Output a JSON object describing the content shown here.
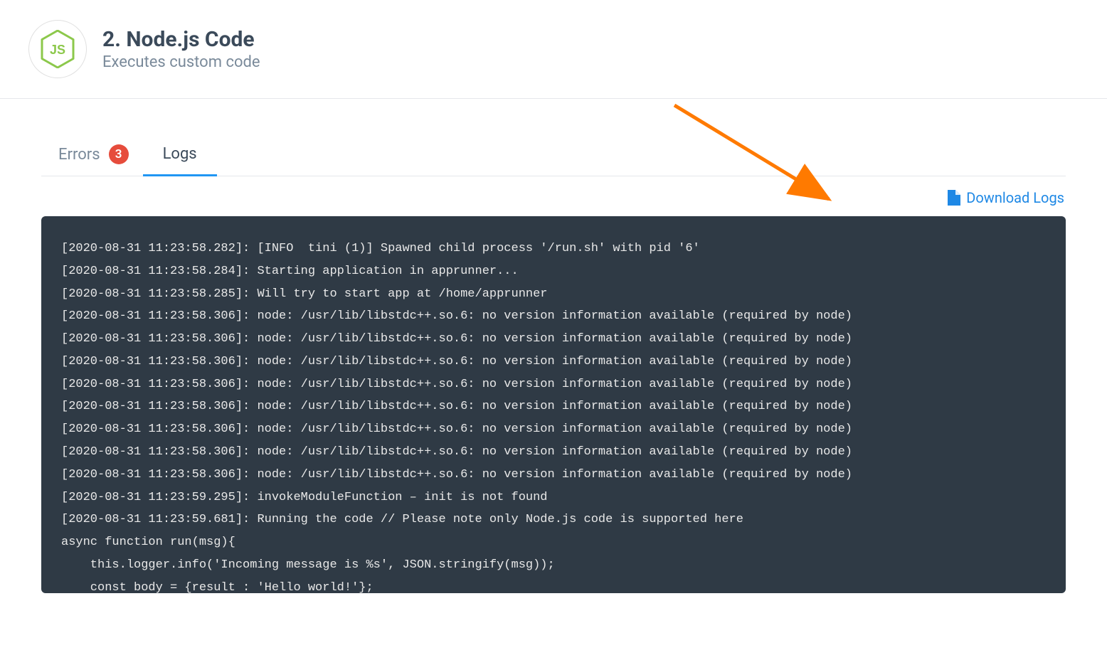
{
  "header": {
    "title": "2. Node.js Code",
    "subtitle": "Executes custom code"
  },
  "tabs": {
    "errors": {
      "label": "Errors",
      "count": "3"
    },
    "logs": {
      "label": "Logs"
    },
    "active": "logs"
  },
  "actions": {
    "download_label": "Download Logs"
  },
  "logs": [
    "[2020-08-31 11:23:58.282]: [INFO  tini (1)] Spawned child process '/run.sh' with pid '6'",
    "[2020-08-31 11:23:58.284]: Starting application in apprunner...",
    "[2020-08-31 11:23:58.285]: Will try to start app at /home/apprunner",
    "[2020-08-31 11:23:58.306]: node: /usr/lib/libstdc++.so.6: no version information available (required by node)",
    "[2020-08-31 11:23:58.306]: node: /usr/lib/libstdc++.so.6: no version information available (required by node)",
    "[2020-08-31 11:23:58.306]: node: /usr/lib/libstdc++.so.6: no version information available (required by node)",
    "[2020-08-31 11:23:58.306]: node: /usr/lib/libstdc++.so.6: no version information available (required by node)",
    "[2020-08-31 11:23:58.306]: node: /usr/lib/libstdc++.so.6: no version information available (required by node)",
    "[2020-08-31 11:23:58.306]: node: /usr/lib/libstdc++.so.6: no version information available (required by node)",
    "[2020-08-31 11:23:58.306]: node: /usr/lib/libstdc++.so.6: no version information available (required by node)",
    "[2020-08-31 11:23:58.306]: node: /usr/lib/libstdc++.so.6: no version information available (required by node)",
    "[2020-08-31 11:23:59.295]: invokeModuleFunction – init is not found",
    "[2020-08-31 11:23:59.681]: Running the code // Please note only Node.js code is supported here",
    "async function run(msg){",
    "    this.logger.info('Incoming message is %s', JSON.stringify(msg));",
    "    const body = {result : 'Hello world!'};"
  ]
}
